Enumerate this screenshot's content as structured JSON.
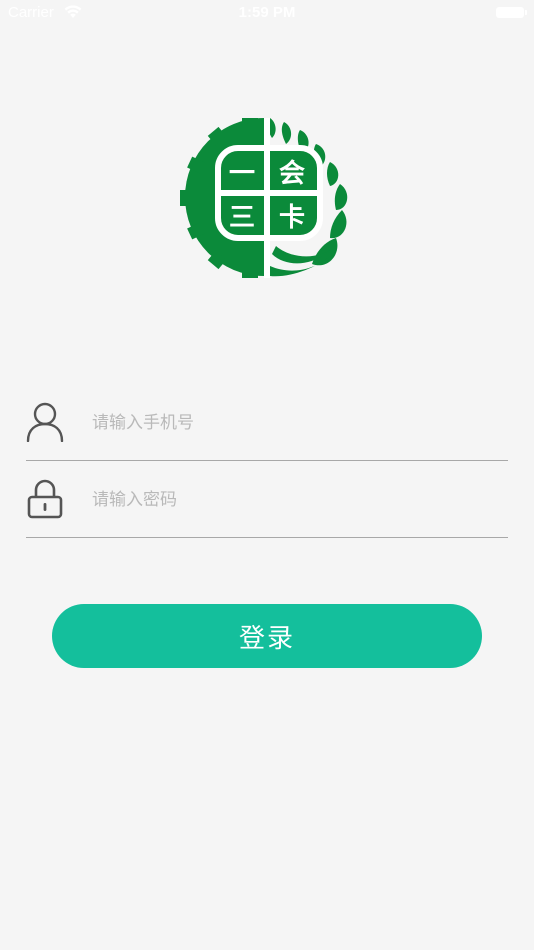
{
  "status_bar": {
    "carrier": "Carrier",
    "time": "1:59 PM",
    "wifi_icon": "wifi-icon",
    "battery_icon": "battery-icon"
  },
  "logo": {
    "chars": [
      "一",
      "会",
      "三",
      "卡"
    ],
    "color": "#0b8a3a"
  },
  "phone_field": {
    "placeholder": "请输入手机号",
    "value": "",
    "icon": "user-icon"
  },
  "password_field": {
    "placeholder": "请输入密码",
    "value": "",
    "icon": "lock-icon"
  },
  "login_button": {
    "label": "登录",
    "color": "#14bf9c"
  }
}
